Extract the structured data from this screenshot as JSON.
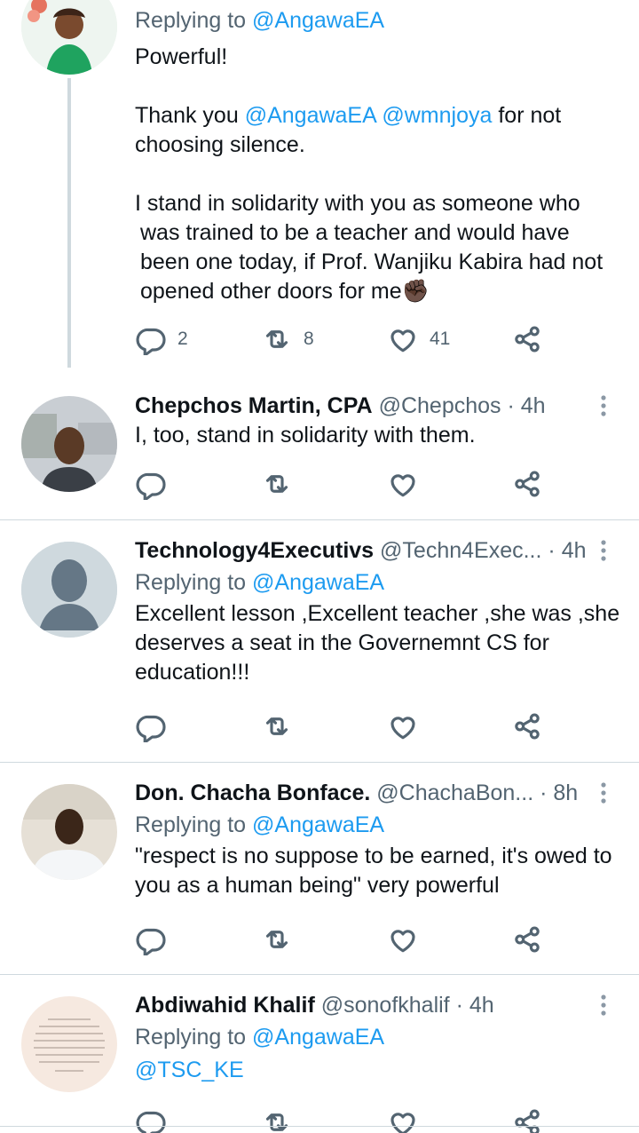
{
  "tweets": [
    {
      "reply_prefix": "Replying to",
      "reply_to": "@AngawaEA",
      "lines": {
        "l1": "Powerful!",
        "l2_pre": "Thank you",
        "m1": "@AngawaEA",
        "m2": "@wmnjoya",
        "l2_post": "for not choosing silence.",
        "l3": "I stand in solidarity with you as someone who was trained to be a teacher and would have been one today, if Prof. Wanjiku Kabira had not opened other doors for me✊🏿"
      },
      "replies": "2",
      "retweets": "8",
      "likes": "41"
    },
    {
      "name": "Chepchos Martin, CPA",
      "handle": "@Chepchos",
      "time": "4h",
      "text": "I, too, stand in solidarity with them."
    },
    {
      "name": "Technology4Executivs",
      "handle": "@Techn4Exec...",
      "time": "4h",
      "reply_prefix": "Replying to",
      "reply_to": "@AngawaEA",
      "text": "Excellent lesson ,Excellent teacher ,she was ,she deserves a seat in the Governemnt CS for education!!!"
    },
    {
      "name": "Don. Chacha Bonface.",
      "handle": "@ChachaBon...",
      "time": "8h",
      "reply_prefix": "Replying to",
      "reply_to": "@AngawaEA",
      "text": "\"respect is no suppose to be earned, it's owed to you as a human being\" very powerful"
    },
    {
      "name": "Abdiwahid Khalif",
      "handle": "@sonofkhalif",
      "time": "4h",
      "reply_prefix": "Replying to",
      "reply_to": "@AngawaEA",
      "mention": "@TSC_KE"
    }
  ],
  "dot_sep": "·",
  "colors": {
    "accent": "#1d9bf0",
    "secondary": "#536471",
    "divider": "#cfd9de"
  },
  "icons": [
    "reply-icon",
    "retweet-icon",
    "like-icon",
    "share-icon",
    "more-icon",
    "default-avatar-icon"
  ]
}
